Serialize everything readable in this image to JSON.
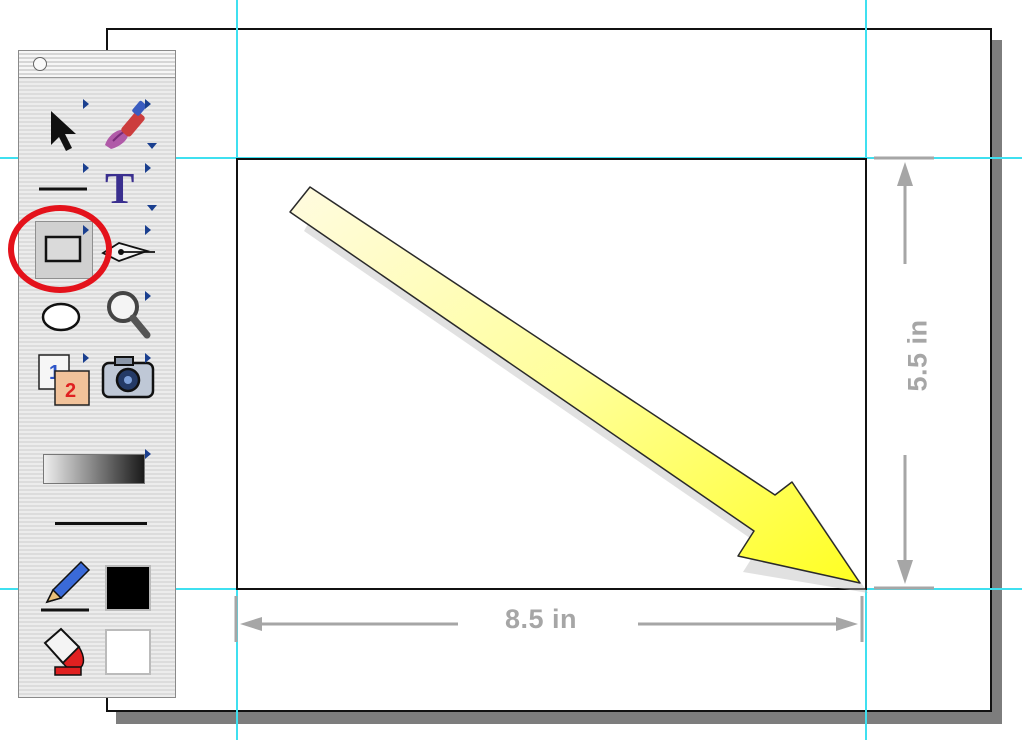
{
  "window": {
    "close_button": "close"
  },
  "tools": [
    {
      "name": "selection-tool",
      "icon": "arrow-pointer-icon"
    },
    {
      "name": "paintbrush-tool",
      "icon": "paintbrush-icon"
    },
    {
      "name": "line-tool",
      "icon": "line-icon"
    },
    {
      "name": "text-tool",
      "icon": "text-icon",
      "glyph": "T"
    },
    {
      "name": "rectangle-tool",
      "icon": "rectangle-icon",
      "selected": true
    },
    {
      "name": "pen-tool",
      "icon": "pen-nib-icon"
    },
    {
      "name": "oval-tool",
      "icon": "oval-icon"
    },
    {
      "name": "zoom-tool",
      "icon": "magnifier-icon"
    },
    {
      "name": "page-tool",
      "icon": "pages-icon",
      "labels": [
        "1",
        "2"
      ]
    },
    {
      "name": "camera-tool",
      "icon": "camera-icon"
    }
  ],
  "gradient": {
    "from": "#eeeeee",
    "to": "#1a1a1a"
  },
  "stroke_color": "#000000",
  "fill_color": "#ffffff",
  "highlight_color": "#e4121b",
  "guide_color": "#3fe0f0",
  "arrow_color": "#ffff33",
  "dimensions": {
    "width_label": "8.5 in",
    "height_label": "5.5 in"
  }
}
